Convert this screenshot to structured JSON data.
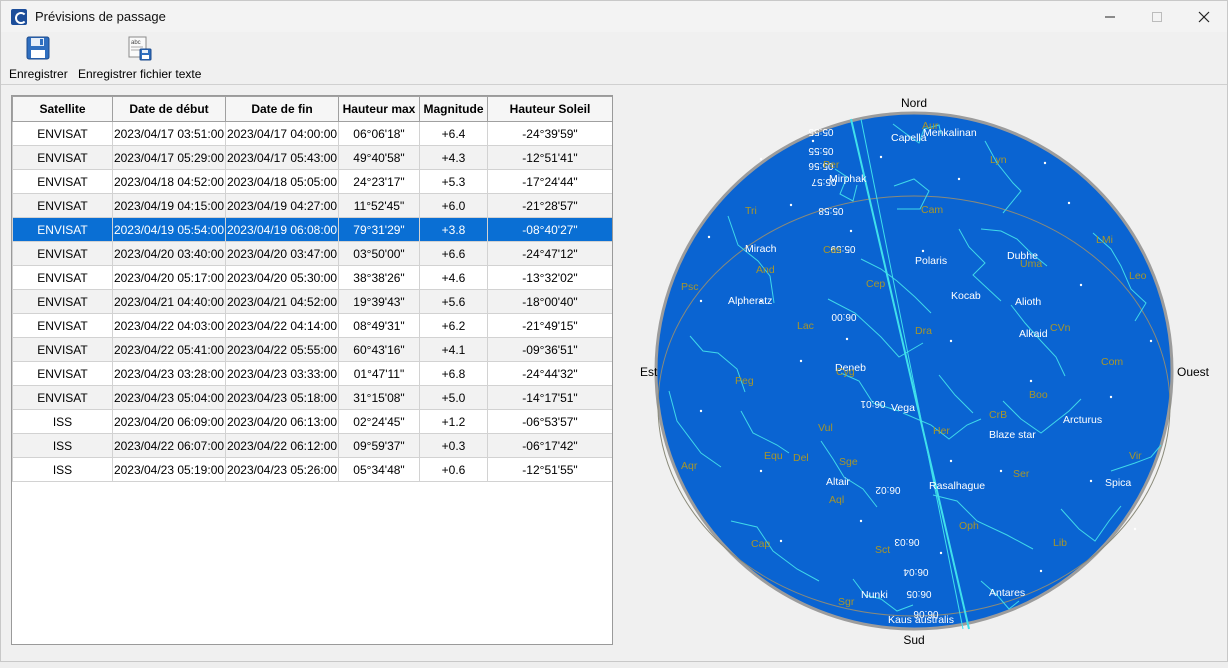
{
  "window": {
    "title": "Prévisions de passage"
  },
  "toolbar": {
    "save_label": "Enregistrer",
    "save_text_label": "Enregistrer fichier texte"
  },
  "table": {
    "columns": [
      "Satellite",
      "Date de début",
      "Date de fin",
      "Hauteur max",
      "Magnitude",
      "Hauteur Soleil"
    ],
    "selected_row": 4,
    "rows": [
      [
        "ENVISAT",
        "2023/04/17 03:51:00",
        "2023/04/17 04:00:00",
        "06°06'18\"",
        "+6.4",
        "-24°39'59\""
      ],
      [
        "ENVISAT",
        "2023/04/17 05:29:00",
        "2023/04/17 05:43:00",
        "49°40'58\"",
        "+4.3",
        "-12°51'41\""
      ],
      [
        "ENVISAT",
        "2023/04/18 04:52:00",
        "2023/04/18 05:05:00",
        "24°23'17\"",
        "+5.3",
        "-17°24'44\""
      ],
      [
        "ENVISAT",
        "2023/04/19 04:15:00",
        "2023/04/19 04:27:00",
        "11°52'45\"",
        "+6.0",
        "-21°28'57\""
      ],
      [
        "ENVISAT",
        "2023/04/19 05:54:00",
        "2023/04/19 06:08:00",
        "79°31'29\"",
        "+3.8",
        "-08°40'27\""
      ],
      [
        "ENVISAT",
        "2023/04/20 03:40:00",
        "2023/04/20 03:47:00",
        "03°50'00\"",
        "+6.6",
        "-24°47'12\""
      ],
      [
        "ENVISAT",
        "2023/04/20 05:17:00",
        "2023/04/20 05:30:00",
        "38°38'26\"",
        "+4.6",
        "-13°32'02\""
      ],
      [
        "ENVISAT",
        "2023/04/21 04:40:00",
        "2023/04/21 04:52:00",
        "19°39'43\"",
        "+5.6",
        "-18°00'40\""
      ],
      [
        "ENVISAT",
        "2023/04/22 04:03:00",
        "2023/04/22 04:14:00",
        "08°49'31\"",
        "+6.2",
        "-21°49'15\""
      ],
      [
        "ENVISAT",
        "2023/04/22 05:41:00",
        "2023/04/22 05:55:00",
        "60°43'16\"",
        "+4.1",
        "-09°36'51\""
      ],
      [
        "ENVISAT",
        "2023/04/23 03:28:00",
        "2023/04/23 03:33:00",
        "01°47'11\"",
        "+6.8",
        "-24°44'32\""
      ],
      [
        "ENVISAT",
        "2023/04/23 05:04:00",
        "2023/04/23 05:18:00",
        "31°15'08\"",
        "+5.0",
        "-14°17'51\""
      ],
      [
        "ISS",
        "2023/04/20 06:09:00",
        "2023/04/20 06:13:00",
        "02°24'45\"",
        "+1.2",
        "-06°53'57\""
      ],
      [
        "ISS",
        "2023/04/22 06:07:00",
        "2023/04/22 06:12:00",
        "09°59'37\"",
        "+0.3",
        "-06°17'42\""
      ],
      [
        "ISS",
        "2023/04/23 05:19:00",
        "2023/04/23 05:26:00",
        "05°34'48\"",
        "+0.6",
        "-12°51'55\""
      ]
    ]
  },
  "sky_map": {
    "directions": {
      "north": "Nord",
      "south": "Sud",
      "east": "Est",
      "west": "Ouest"
    },
    "colors": {
      "sky": "#0a64d2",
      "constellation_line": "#3fd8ea",
      "track": "#3fe0ec",
      "const_label": "#a8962a",
      "star_label": "#ffffff",
      "rim": "#9c9c9c"
    },
    "star_names": [
      "Capella",
      "Menkalinan",
      "Mirphak",
      "Mirach",
      "Polaris",
      "Dubhe",
      "Alpheratz",
      "Kocab",
      "Alioth",
      "Alkaid",
      "Deneb",
      "Vega",
      "Arcturus",
      "Blaze star",
      "Altair",
      "Rasalhague",
      "Spica",
      "Nunki",
      "Antares",
      "Kaus australis"
    ],
    "constellation_abbrevs": [
      "Aur",
      "Per",
      "Lyn",
      "Tri",
      "Cam",
      "Cas",
      "LMi",
      "Uma",
      "And",
      "Psc",
      "Cep",
      "Leo",
      "Lac",
      "Dra",
      "CVn",
      "Com",
      "Peg",
      "Boo",
      "Cyg",
      "CrB",
      "Vul",
      "Her",
      "Equ",
      "Del",
      "Sge",
      "Aqr",
      "Ser",
      "Vir",
      "Aql",
      "Oph",
      "Lib",
      "Sct",
      "Cap",
      "Sgr"
    ],
    "track_times": [
      "05:55",
      "05:55",
      "05:56",
      "05:57",
      "05:58",
      "05:59",
      "06:00",
      "06:01",
      "06:02",
      "06:03",
      "06:04",
      "06:05",
      "06:06"
    ]
  }
}
